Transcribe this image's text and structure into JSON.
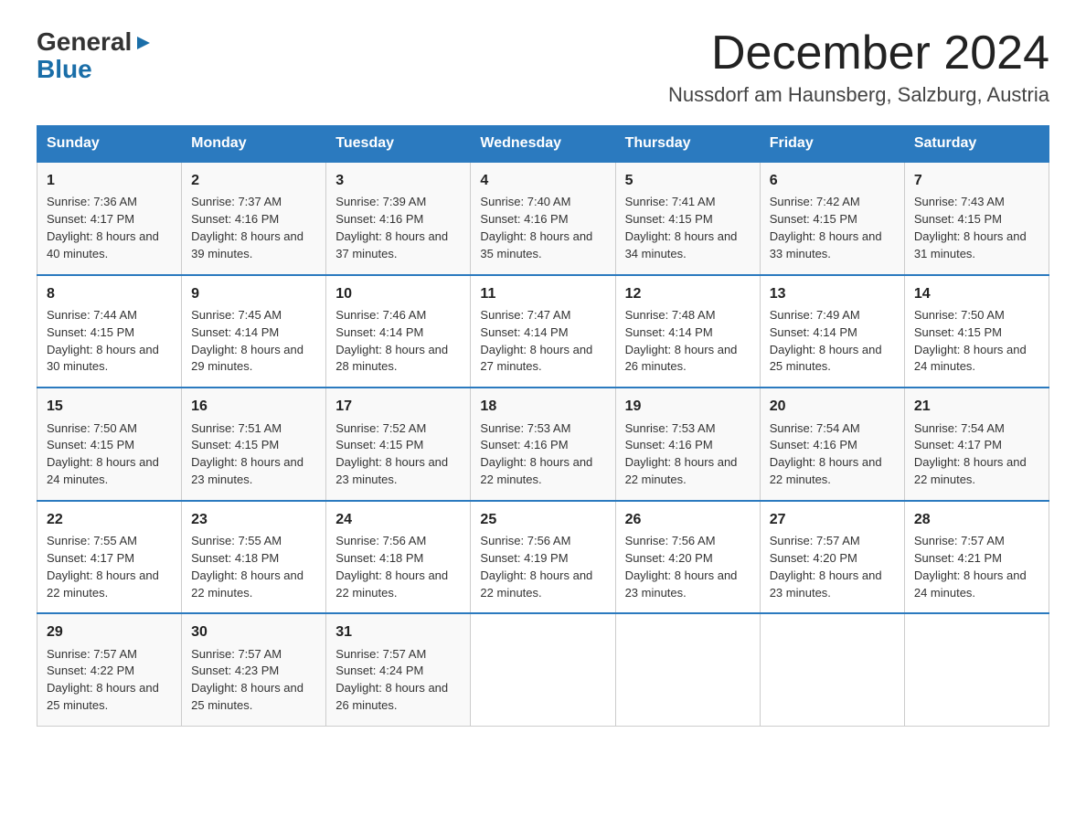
{
  "logo": {
    "general": "General",
    "blue": "Blue",
    "arrow": "▶"
  },
  "title": "December 2024",
  "location": "Nussdorf am Haunsberg, Salzburg, Austria",
  "columns": [
    "Sunday",
    "Monday",
    "Tuesday",
    "Wednesday",
    "Thursday",
    "Friday",
    "Saturday"
  ],
  "weeks": [
    [
      {
        "day": "1",
        "sunrise": "7:36 AM",
        "sunset": "4:17 PM",
        "daylight": "8 hours and 40 minutes."
      },
      {
        "day": "2",
        "sunrise": "7:37 AM",
        "sunset": "4:16 PM",
        "daylight": "8 hours and 39 minutes."
      },
      {
        "day": "3",
        "sunrise": "7:39 AM",
        "sunset": "4:16 PM",
        "daylight": "8 hours and 37 minutes."
      },
      {
        "day": "4",
        "sunrise": "7:40 AM",
        "sunset": "4:16 PM",
        "daylight": "8 hours and 35 minutes."
      },
      {
        "day": "5",
        "sunrise": "7:41 AM",
        "sunset": "4:15 PM",
        "daylight": "8 hours and 34 minutes."
      },
      {
        "day": "6",
        "sunrise": "7:42 AM",
        "sunset": "4:15 PM",
        "daylight": "8 hours and 33 minutes."
      },
      {
        "day": "7",
        "sunrise": "7:43 AM",
        "sunset": "4:15 PM",
        "daylight": "8 hours and 31 minutes."
      }
    ],
    [
      {
        "day": "8",
        "sunrise": "7:44 AM",
        "sunset": "4:15 PM",
        "daylight": "8 hours and 30 minutes."
      },
      {
        "day": "9",
        "sunrise": "7:45 AM",
        "sunset": "4:14 PM",
        "daylight": "8 hours and 29 minutes."
      },
      {
        "day": "10",
        "sunrise": "7:46 AM",
        "sunset": "4:14 PM",
        "daylight": "8 hours and 28 minutes."
      },
      {
        "day": "11",
        "sunrise": "7:47 AM",
        "sunset": "4:14 PM",
        "daylight": "8 hours and 27 minutes."
      },
      {
        "day": "12",
        "sunrise": "7:48 AM",
        "sunset": "4:14 PM",
        "daylight": "8 hours and 26 minutes."
      },
      {
        "day": "13",
        "sunrise": "7:49 AM",
        "sunset": "4:14 PM",
        "daylight": "8 hours and 25 minutes."
      },
      {
        "day": "14",
        "sunrise": "7:50 AM",
        "sunset": "4:15 PM",
        "daylight": "8 hours and 24 minutes."
      }
    ],
    [
      {
        "day": "15",
        "sunrise": "7:50 AM",
        "sunset": "4:15 PM",
        "daylight": "8 hours and 24 minutes."
      },
      {
        "day": "16",
        "sunrise": "7:51 AM",
        "sunset": "4:15 PM",
        "daylight": "8 hours and 23 minutes."
      },
      {
        "day": "17",
        "sunrise": "7:52 AM",
        "sunset": "4:15 PM",
        "daylight": "8 hours and 23 minutes."
      },
      {
        "day": "18",
        "sunrise": "7:53 AM",
        "sunset": "4:16 PM",
        "daylight": "8 hours and 22 minutes."
      },
      {
        "day": "19",
        "sunrise": "7:53 AM",
        "sunset": "4:16 PM",
        "daylight": "8 hours and 22 minutes."
      },
      {
        "day": "20",
        "sunrise": "7:54 AM",
        "sunset": "4:16 PM",
        "daylight": "8 hours and 22 minutes."
      },
      {
        "day": "21",
        "sunrise": "7:54 AM",
        "sunset": "4:17 PM",
        "daylight": "8 hours and 22 minutes."
      }
    ],
    [
      {
        "day": "22",
        "sunrise": "7:55 AM",
        "sunset": "4:17 PM",
        "daylight": "8 hours and 22 minutes."
      },
      {
        "day": "23",
        "sunrise": "7:55 AM",
        "sunset": "4:18 PM",
        "daylight": "8 hours and 22 minutes."
      },
      {
        "day": "24",
        "sunrise": "7:56 AM",
        "sunset": "4:18 PM",
        "daylight": "8 hours and 22 minutes."
      },
      {
        "day": "25",
        "sunrise": "7:56 AM",
        "sunset": "4:19 PM",
        "daylight": "8 hours and 22 minutes."
      },
      {
        "day": "26",
        "sunrise": "7:56 AM",
        "sunset": "4:20 PM",
        "daylight": "8 hours and 23 minutes."
      },
      {
        "day": "27",
        "sunrise": "7:57 AM",
        "sunset": "4:20 PM",
        "daylight": "8 hours and 23 minutes."
      },
      {
        "day": "28",
        "sunrise": "7:57 AM",
        "sunset": "4:21 PM",
        "daylight": "8 hours and 24 minutes."
      }
    ],
    [
      {
        "day": "29",
        "sunrise": "7:57 AM",
        "sunset": "4:22 PM",
        "daylight": "8 hours and 25 minutes."
      },
      {
        "day": "30",
        "sunrise": "7:57 AM",
        "sunset": "4:23 PM",
        "daylight": "8 hours and 25 minutes."
      },
      {
        "day": "31",
        "sunrise": "7:57 AM",
        "sunset": "4:24 PM",
        "daylight": "8 hours and 26 minutes."
      },
      null,
      null,
      null,
      null
    ]
  ]
}
